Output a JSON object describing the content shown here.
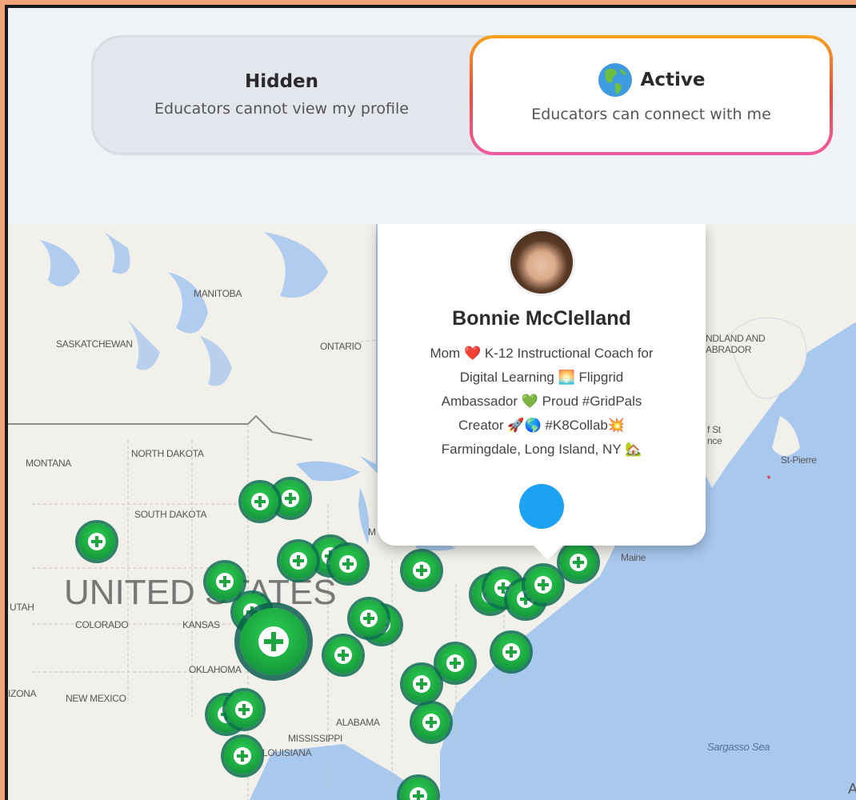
{
  "visibility_toggle": {
    "hidden": {
      "title": "Hidden",
      "subtitle": "Educators cannot view my profile"
    },
    "active": {
      "title": "Active",
      "subtitle": "Educators can connect with me",
      "icon": "globe-americas-icon"
    },
    "selected": "active"
  },
  "map": {
    "labels": {
      "manitoba": "MANITOBA",
      "saskatchewan": "SASKATCHEWAN",
      "ontario": "ONTARIO",
      "newfoundland": "NDLAND AND",
      "labrador": "ABRADOR",
      "montana": "MONTANA",
      "north_dakota": "NORTH DAKOTA",
      "south_dakota": "SOUTH DAKOTA",
      "united_states": "UNITED STATES",
      "utah": "UTAH",
      "colorado": "COLORADO",
      "kansas": "KANSAS",
      "oklahoma": "OKLAHOMA",
      "arizona": "IZONA",
      "new_mexico": "NEW MEXICO",
      "alabama": "ALABAMA",
      "mississippi": "MISSISSIPPI",
      "louisiana": "LOUISIANA",
      "maine": "Maine",
      "st_pierre": "St-Pierre",
      "st_fragment": "f St",
      "nce_fragment": "nce",
      "sargasso": "Sargasso Sea",
      "m_fragment": "M",
      "a_fragment": "A"
    },
    "colors": {
      "water": "#a9c8ee",
      "land": "#f2f0ea",
      "marker": "#1aa53f"
    }
  },
  "profile_popup": {
    "name": "Bonnie McClelland",
    "bio_lines": [
      "Mom ❤️ K-12 Instructional Coach for",
      "Digital Learning 🌅 Flipgrid",
      "Ambassador 💚 Proud #GridPals",
      "Creator 🚀🌎 #K8Collab💥",
      "Farmingdale, Long Island, NY 🏡"
    ],
    "social": "twitter-icon"
  }
}
